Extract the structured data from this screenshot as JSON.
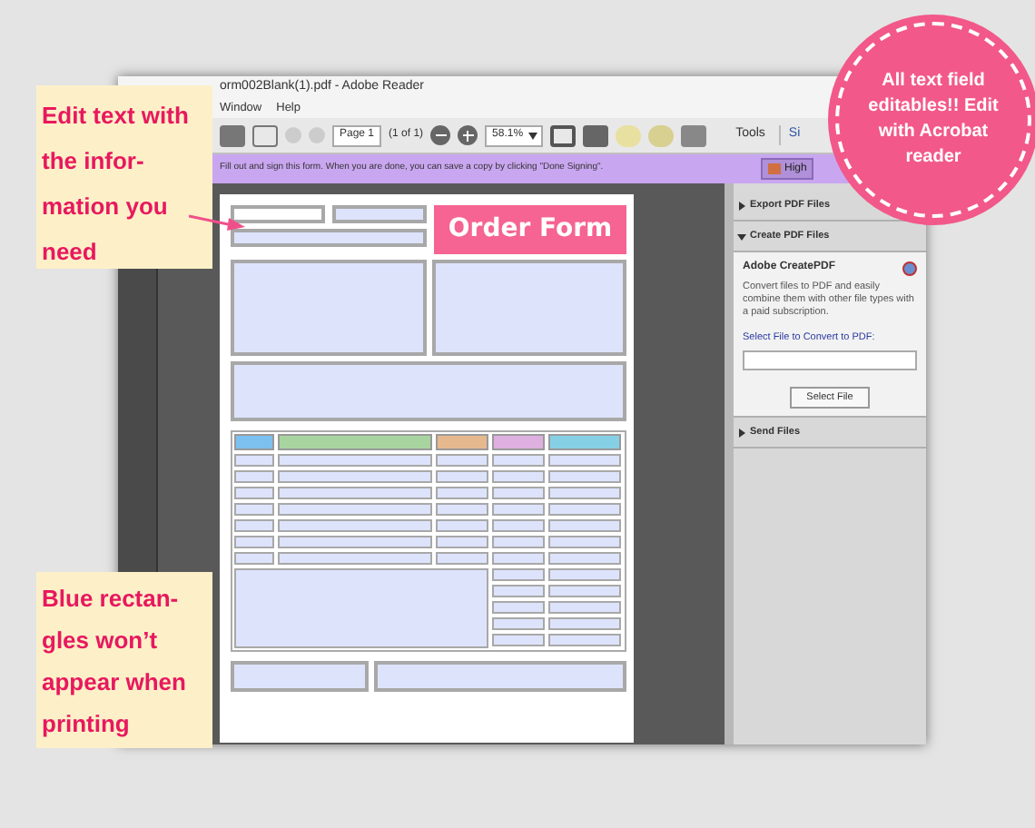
{
  "window": {
    "title": "orm002Blank(1).pdf - Adobe Reader"
  },
  "menu": [
    "Window",
    "Help"
  ],
  "toolbar": {
    "page_field": "Page 1",
    "page_count": "(1 of 1)",
    "zoom_field": "58.1%",
    "tools": "Tools",
    "sign": "Si"
  },
  "message_bar": {
    "text": "Fill out and sign this form. When you are done, you can save a copy by clicking \"Done Signing\".",
    "button": "High"
  },
  "document": {
    "banner": "Order Form",
    "table_columns": [
      {
        "color": "#7cc0ef"
      },
      {
        "color": "#a8d4a0"
      },
      {
        "color": "#e6b88e"
      },
      {
        "color": "#deb0e0"
      },
      {
        "color": "#86d0e6"
      }
    ]
  },
  "side_panel": {
    "sections": [
      {
        "title": "Export PDF Files",
        "expanded": false
      },
      {
        "title": "Create PDF Files",
        "expanded": true,
        "heading": "Adobe CreatePDF",
        "description": "Convert files to PDF and easily combine them with other file types with a paid subscription.",
        "field_label": "Select File to Convert to PDF:",
        "button": "Select File"
      },
      {
        "title": "Send Files",
        "expanded": false
      }
    ]
  },
  "callouts": [
    "Edit text with the infor-mation you need",
    "Blue rectan-gles won’t appear when printing"
  ],
  "badge": "All text field editables!! Edit with Acrobat reader"
}
